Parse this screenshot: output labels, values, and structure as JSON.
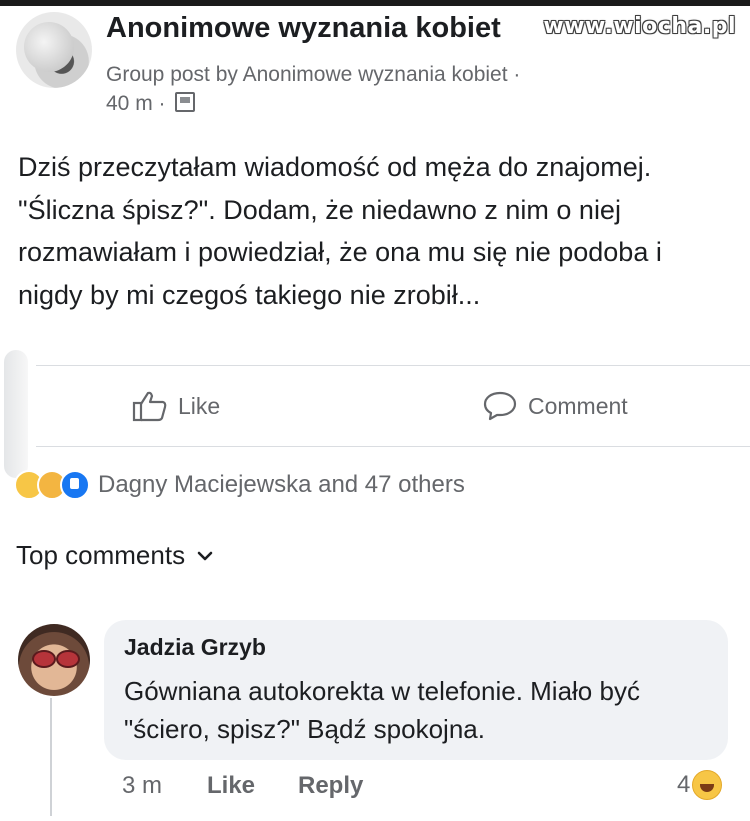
{
  "watermark": "www.wiocha.pl",
  "post": {
    "group_name": "Anonimowe wyznania kobiet",
    "meta_line": "Group post by Anonimowe wyznania kobiet ·",
    "time": "40 m ·",
    "audience_icon": "group-audience-icon",
    "body": "Dziś przeczytałam wiadomość od męża do znajomej. \"Śliczna śpisz?\". Dodam, że niedawno z nim o niej rozmawiałam i powiedział, że ona mu się nie podoba i nigdy by mi czegoś takiego nie zrobił..."
  },
  "actions": {
    "like_label": "Like",
    "comment_label": "Comment"
  },
  "reactions": {
    "icons": [
      "sad-icon",
      "care-icon",
      "like-icon"
    ],
    "summary": "Dagny Maciejewska and 47 others"
  },
  "comments_header": {
    "label": "Top comments"
  },
  "comment": {
    "author": "Jadzia Grzyb",
    "text": "Gówniana autokorekta w telefonie. Miało być \"ściero, spisz?\" Bądź spokojna.",
    "time": "3 m",
    "like_label": "Like",
    "reply_label": "Reply",
    "reaction_count": "4",
    "reaction_icon": "laugh-icon"
  },
  "colors": {
    "text_primary": "#1c1e21",
    "text_secondary": "#65676b",
    "bubble_bg": "#f0f2f5",
    "like_blue": "#1877f2"
  }
}
